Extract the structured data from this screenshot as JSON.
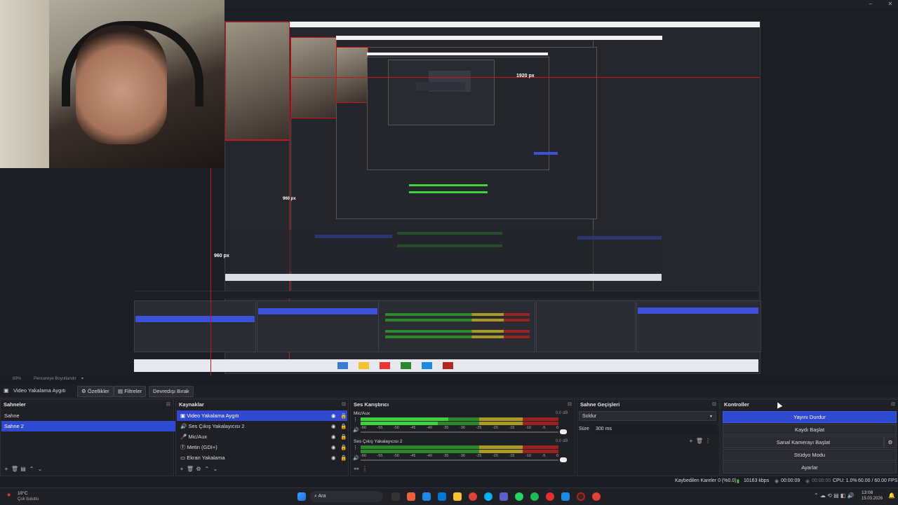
{
  "window": {
    "minimize": "–",
    "maximize": "❐",
    "close": "✕"
  },
  "preview": {
    "label_1920": "1920 px",
    "label_960": "960 px"
  },
  "dock_status": {
    "zoom": "69%",
    "fit": "Pencereye Boyutlandır"
  },
  "toolbar": {
    "source_name": "Video Yakalama Aygıtı",
    "properties": "Özellikler",
    "filters": "Filtreler",
    "deactivate": "Devredışı Bırak"
  },
  "scenes": {
    "title": "Sahneler",
    "items": [
      {
        "label": "Sahne"
      },
      {
        "label": "Sahne 2"
      }
    ]
  },
  "sources": {
    "title": "Kaynaklar",
    "items": [
      {
        "label": "Video Yakalama Aygıtı",
        "icon": "camera-icon"
      },
      {
        "label": "Ses Çıkış Yakalayıcısı 2",
        "icon": "speaker-icon"
      },
      {
        "label": "Mic/Aux",
        "icon": "mic-icon"
      },
      {
        "label": "Metin (GDI+)",
        "icon": "text-icon"
      },
      {
        "label": "Ekran Yakalama",
        "icon": "monitor-icon"
      }
    ]
  },
  "mixer": {
    "title": "Ses Karıştırıcı",
    "channels": [
      {
        "name": "Mic/Aux",
        "db": "0.0 dB"
      },
      {
        "name": "Ses Çıkış Yakalayıcısı 2",
        "db": "0.0 dB"
      }
    ],
    "scale": [
      "-60",
      "-55",
      "-50",
      "-45",
      "-40",
      "-35",
      "-30",
      "-25",
      "-20",
      "-15",
      "-10",
      "-5",
      "0"
    ]
  },
  "transitions": {
    "title": "Sahne Geçişleri",
    "selected": "Soldur",
    "duration_label": "Süre",
    "duration_value": "300 ms"
  },
  "controls": {
    "title": "Kontroller",
    "buttons": [
      "Yayını Durdur",
      "Kaydı Başlat",
      "Sanal Kamerayı Başlat",
      "Stüdyo Modu",
      "Ayarlar"
    ]
  },
  "status": {
    "dropped": "Kaybedilen Kareler 0 (%0.0)",
    "bitrate": "10163 kbps",
    "stream_time": "00:00:09",
    "rec_time": "00:00:00",
    "cpu": "CPU: 1.0%",
    "fps": "60.00 / 60.00 FPS"
  },
  "taskbar": {
    "weather_temp": "10°C",
    "weather_desc": "Çok bulutlu",
    "search": "Ara",
    "time": "13:08",
    "date": "15.03.2026"
  }
}
